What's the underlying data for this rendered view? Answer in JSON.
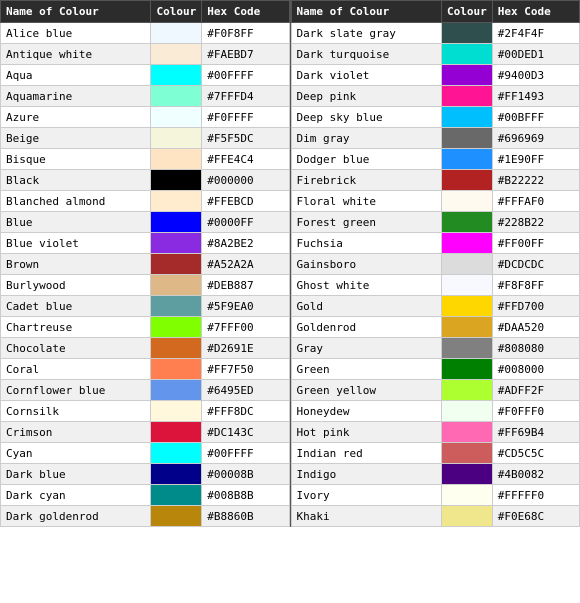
{
  "left_table": {
    "headers": [
      "Name of Colour",
      "Colour",
      "Hex Code"
    ],
    "rows": [
      {
        "name": "Alice blue",
        "hex": "#F0F8FF",
        "color": "#F0F8FF"
      },
      {
        "name": "Antique white",
        "hex": "#FAEBD7",
        "color": "#FAEBD7"
      },
      {
        "name": "Aqua",
        "hex": "#00FFFF",
        "color": "#00FFFF"
      },
      {
        "name": "Aquamarine",
        "hex": "#7FFFD4",
        "color": "#7FFFD4"
      },
      {
        "name": "Azure",
        "hex": "#F0FFFF",
        "color": "#F0FFFF"
      },
      {
        "name": "Beige",
        "hex": "#F5F5DC",
        "color": "#F5F5DC"
      },
      {
        "name": "Bisque",
        "hex": "#FFE4C4",
        "color": "#FFE4C4"
      },
      {
        "name": "Black",
        "hex": "#000000",
        "color": "#000000"
      },
      {
        "name": "Blanched almond",
        "hex": "#FFEBCD",
        "color": "#FFEBCD"
      },
      {
        "name": "Blue",
        "hex": "#0000FF",
        "color": "#0000FF"
      },
      {
        "name": "Blue violet",
        "hex": "#8A2BE2",
        "color": "#8A2BE2"
      },
      {
        "name": "Brown",
        "hex": "#A52A2A",
        "color": "#A52A2A"
      },
      {
        "name": "Burlywood",
        "hex": "#DEB887",
        "color": "#DEB887"
      },
      {
        "name": "Cadet blue",
        "hex": "#5F9EA0",
        "color": "#5F9EA0"
      },
      {
        "name": "Chartreuse",
        "hex": "#7FFF00",
        "color": "#7FFF00"
      },
      {
        "name": "Chocolate",
        "hex": "#D2691E",
        "color": "#D2691E"
      },
      {
        "name": "Coral",
        "hex": "#FF7F50",
        "color": "#FF7F50"
      },
      {
        "name": "Cornflower blue",
        "hex": "#6495ED",
        "color": "#6495ED"
      },
      {
        "name": "Cornsilk",
        "hex": "#FFF8DC",
        "color": "#FFF8DC"
      },
      {
        "name": "Crimson",
        "hex": "#DC143C",
        "color": "#DC143C"
      },
      {
        "name": "Cyan",
        "hex": "#00FFFF",
        "color": "#00FFFF"
      },
      {
        "name": "Dark blue",
        "hex": "#00008B",
        "color": "#00008B"
      },
      {
        "name": "Dark cyan",
        "hex": "#008B8B",
        "color": "#008B8B"
      },
      {
        "name": "Dark goldenrod",
        "hex": "#B8860B",
        "color": "#B8860B"
      }
    ]
  },
  "right_table": {
    "headers": [
      "Name of Colour",
      "Colour",
      "Hex Code"
    ],
    "rows": [
      {
        "name": "Dark slate gray",
        "hex": "#2F4F4F",
        "color": "#2F4F4F"
      },
      {
        "name": "Dark turquoise",
        "hex": "#00DED1",
        "color": "#00DED1"
      },
      {
        "name": "Dark violet",
        "hex": "#9400D3",
        "color": "#9400D3"
      },
      {
        "name": "Deep pink",
        "hex": "#FF1493",
        "color": "#FF1493"
      },
      {
        "name": "Deep sky blue",
        "hex": "#00BFFF",
        "color": "#00BFFF"
      },
      {
        "name": "Dim gray",
        "hex": "#696969",
        "color": "#696969"
      },
      {
        "name": "Dodger blue",
        "hex": "#1E90FF",
        "color": "#1E90FF"
      },
      {
        "name": "Firebrick",
        "hex": "#B22222",
        "color": "#B22222"
      },
      {
        "name": "Floral white",
        "hex": "#FFFAF0",
        "color": "#FFFAF0"
      },
      {
        "name": "Forest green",
        "hex": "#228B22",
        "color": "#228B22"
      },
      {
        "name": "Fuchsia",
        "hex": "#FF00FF",
        "color": "#FF00FF"
      },
      {
        "name": "Gainsboro",
        "hex": "#DCDCDC",
        "color": "#DCDCDC"
      },
      {
        "name": "Ghost white",
        "hex": "#F8F8FF",
        "color": "#F8F8FF"
      },
      {
        "name": "Gold",
        "hex": "#FFD700",
        "color": "#FFD700"
      },
      {
        "name": "Goldenrod",
        "hex": "#DAA520",
        "color": "#DAA520"
      },
      {
        "name": "Gray",
        "hex": "#808080",
        "color": "#808080"
      },
      {
        "name": "Green",
        "hex": "#008000",
        "color": "#008000"
      },
      {
        "name": "Green yellow",
        "hex": "#ADFF2F",
        "color": "#ADFF2F"
      },
      {
        "name": "Honeydew",
        "hex": "#F0FFF0",
        "color": "#F0FFF0"
      },
      {
        "name": "Hot pink",
        "hex": "#FF69B4",
        "color": "#FF69B4"
      },
      {
        "name": "Indian red",
        "hex": "#CD5C5C",
        "color": "#CD5C5C"
      },
      {
        "name": "Indigo",
        "hex": "#4B0082",
        "color": "#4B0082"
      },
      {
        "name": "Ivory",
        "hex": "#FFFFF0",
        "color": "#FFFFF0"
      },
      {
        "name": "Khaki",
        "hex": "#F0E68C",
        "color": "#F0E68C"
      }
    ]
  }
}
